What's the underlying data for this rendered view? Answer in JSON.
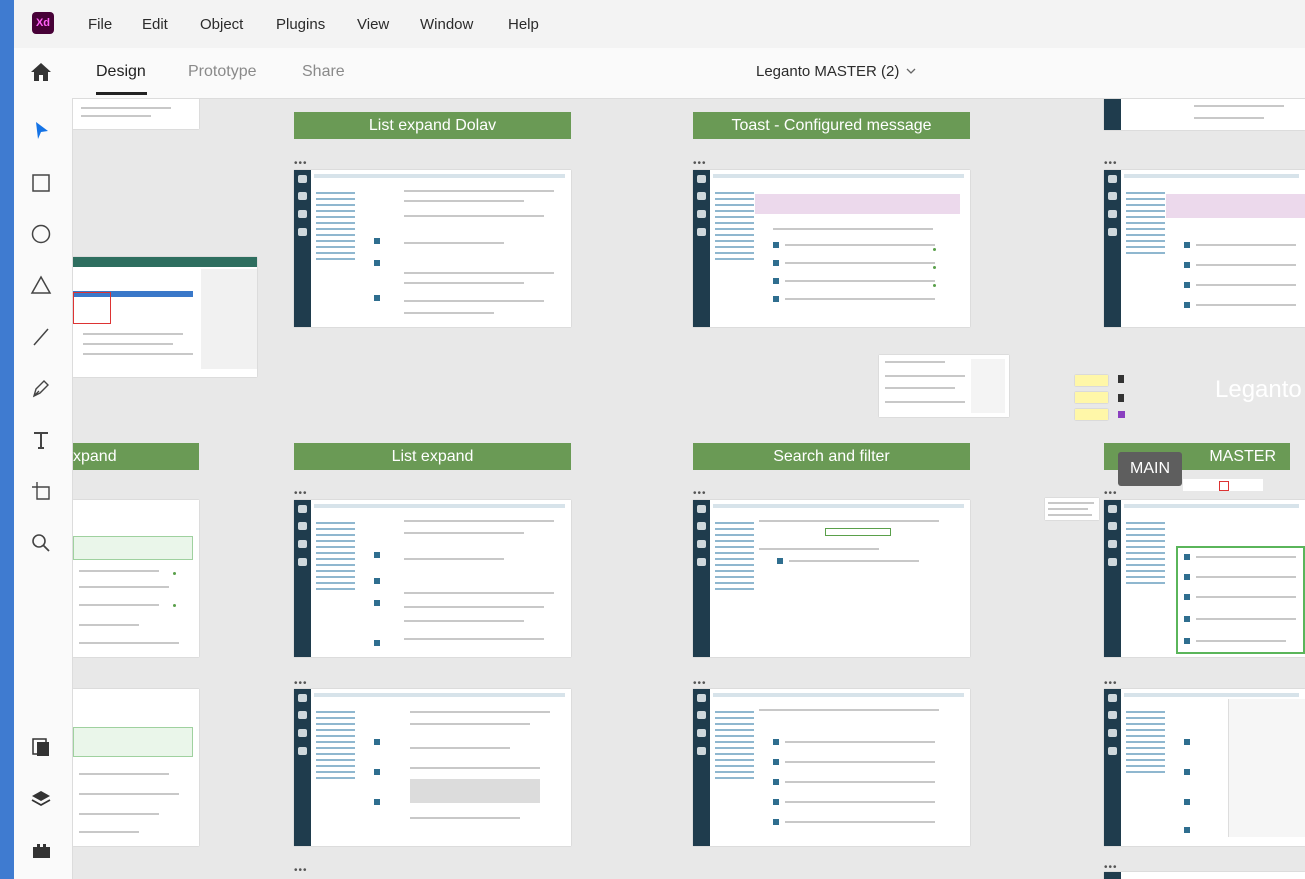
{
  "app": {
    "logo_text": "Xd",
    "brand_color": "#470137",
    "accent_color": "#ff61f6"
  },
  "menu": [
    "File",
    "Edit",
    "Object",
    "Plugins",
    "View",
    "Window",
    "Help"
  ],
  "tabs": {
    "design": "Design",
    "prototype": "Prototype",
    "share": "Share"
  },
  "document": {
    "title": "Leganto MASTER (2)"
  },
  "tools": [
    "select-arrow-icon",
    "rectangle-icon",
    "ellipse-icon",
    "polygon-icon",
    "line-icon",
    "pen-icon",
    "text-icon",
    "artboard-icon",
    "zoom-icon"
  ],
  "bottom_tools": [
    "assets-icon",
    "layers-icon",
    "plugins-icon"
  ],
  "canvas": {
    "banners": {
      "list_expand_dolav": "List expand Dolav",
      "toast": "Toast - Configured message",
      "expand_partial": "xpand",
      "list_expand": "List expand",
      "search_filter": "Search and filter",
      "master": "MASTER"
    },
    "main_badge": "MAIN",
    "watermark": "Leganto",
    "artboard_menu": "•••",
    "banner_color": "#6a9a55"
  }
}
